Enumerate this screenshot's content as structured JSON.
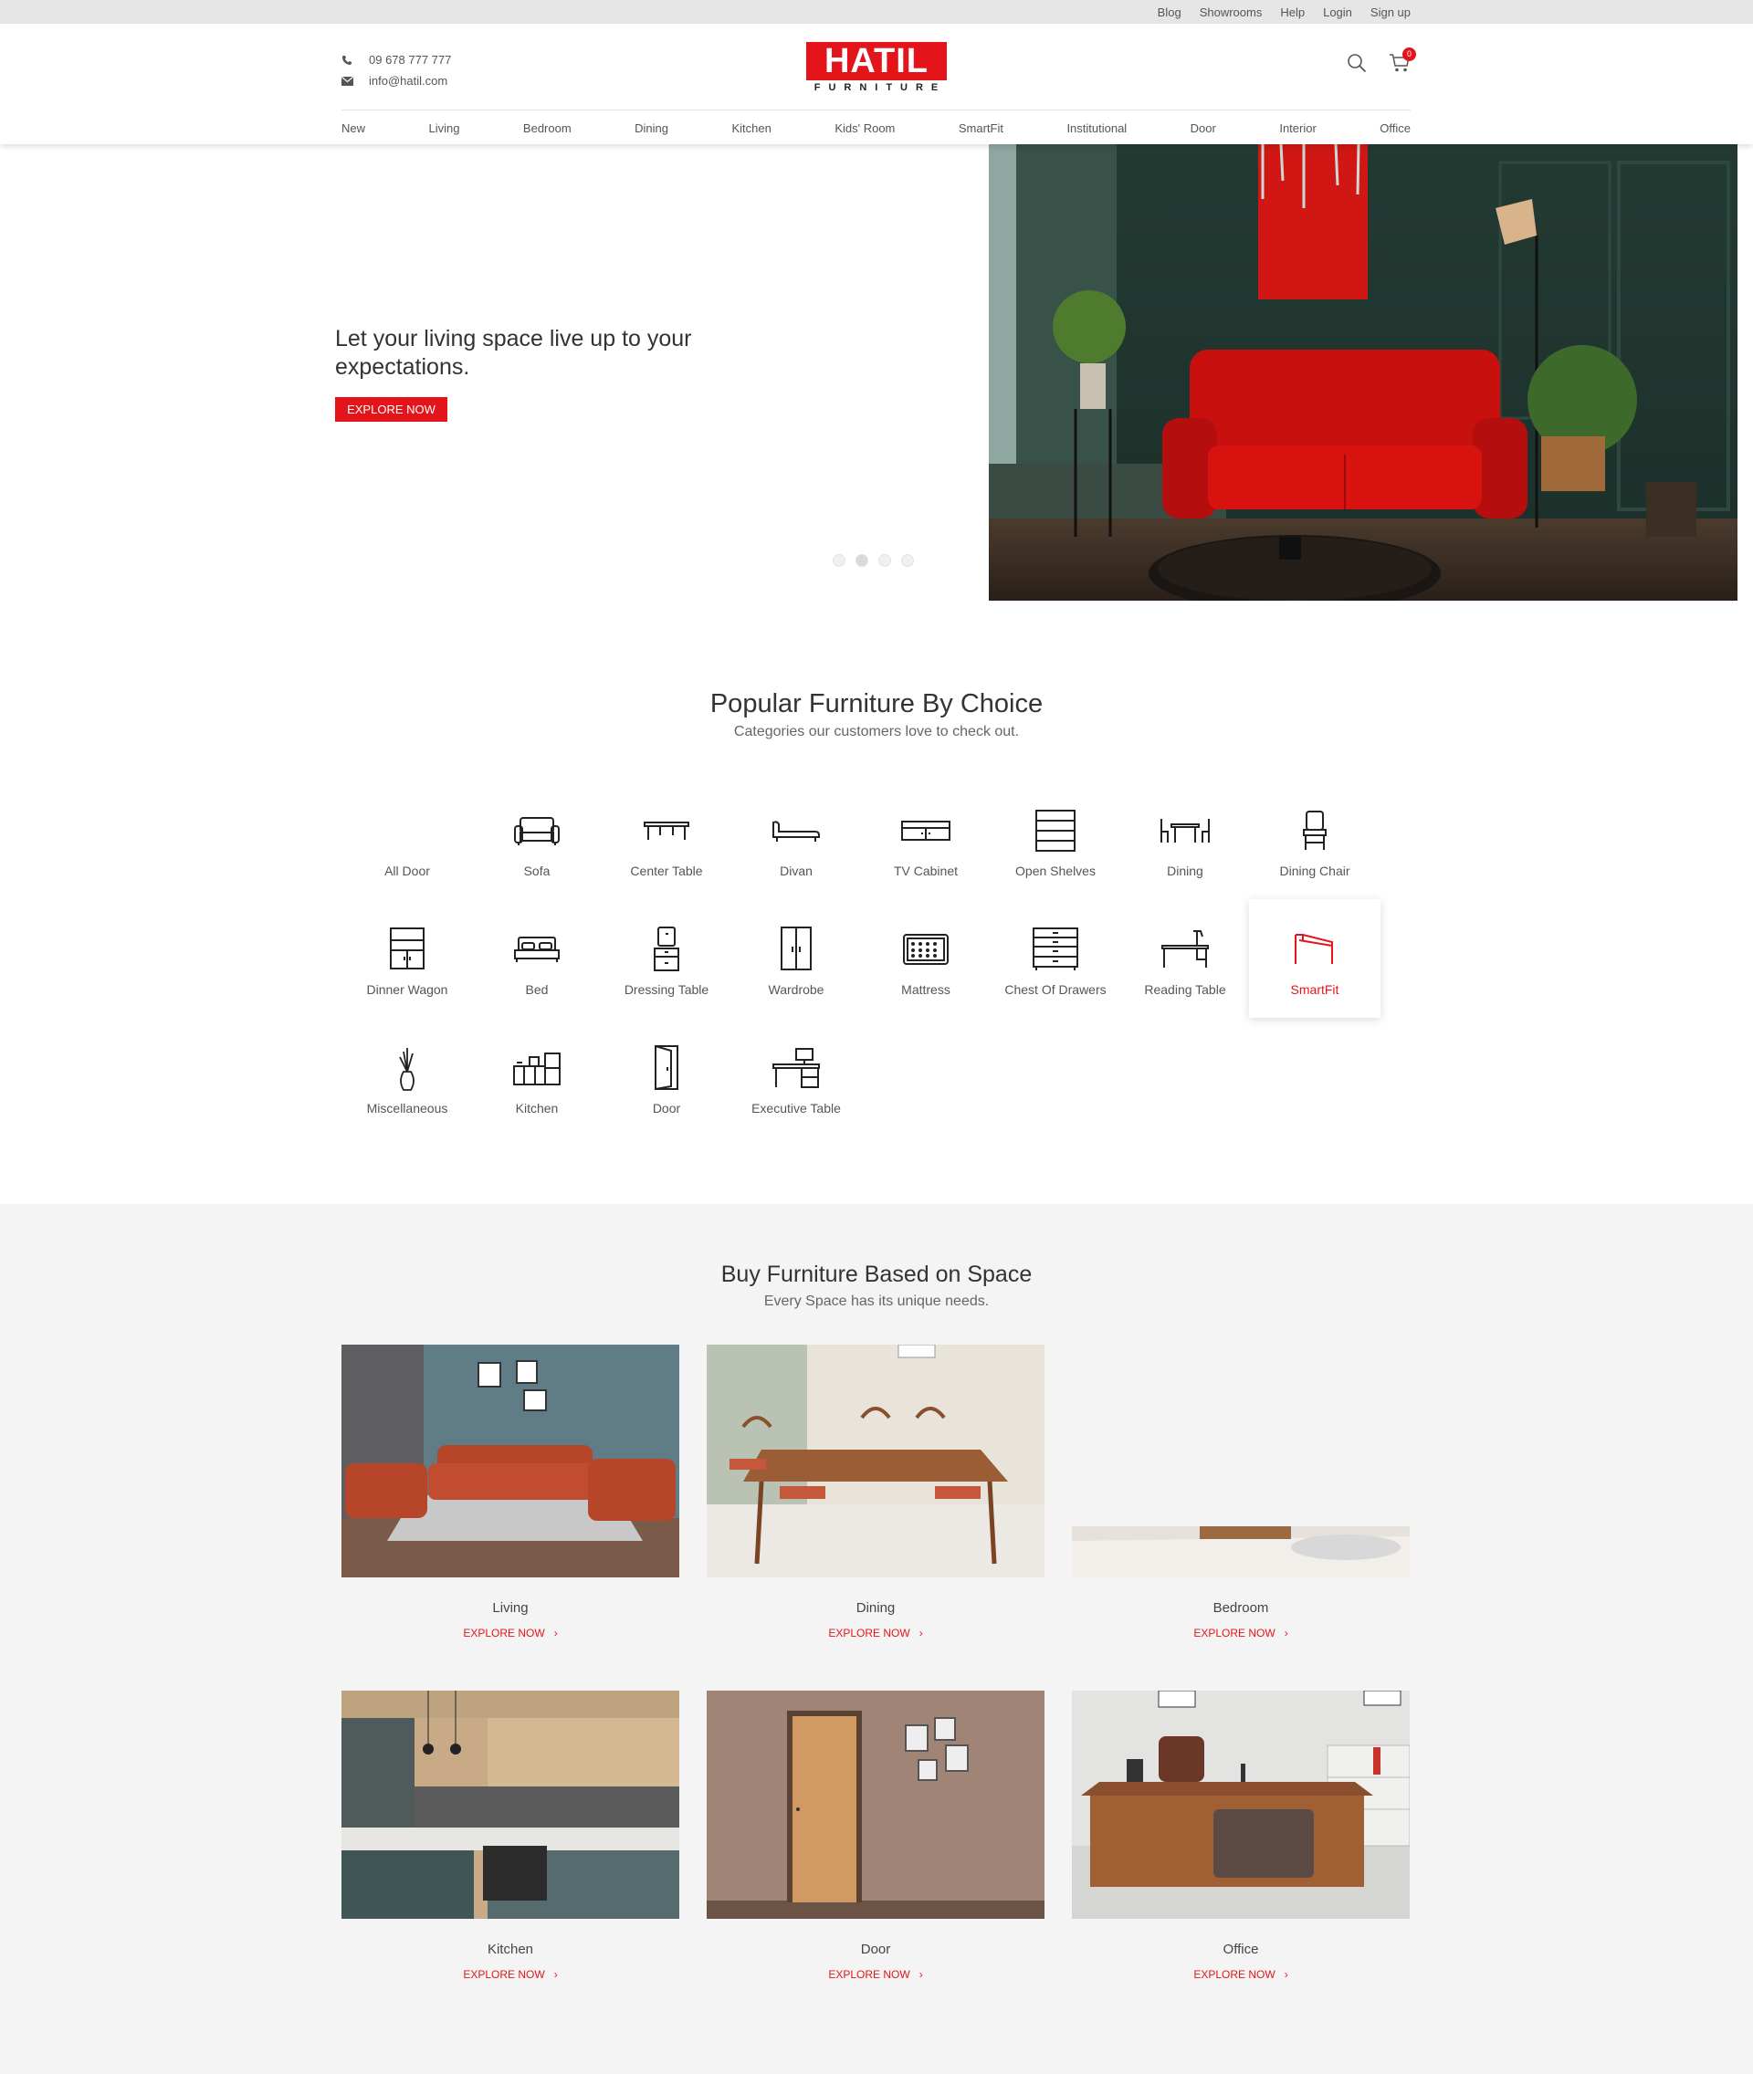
{
  "topbar": {
    "links": [
      "Blog",
      "Showrooms",
      "Help",
      "Login",
      "Sign up"
    ]
  },
  "header": {
    "phone": "09 678 777 777",
    "email": "info@hatil.com",
    "logo_main": "HATIL",
    "logo_sub": "FURNITURE",
    "cart_count": "0"
  },
  "nav": [
    "New",
    "Living",
    "Bedroom",
    "Dining",
    "Kitchen",
    "Kids' Room",
    "SmartFit",
    "Institutional",
    "Door",
    "Interior",
    "Office"
  ],
  "hero": {
    "title": "Let your living space live up to your expectations.",
    "button": "EXPLORE NOW",
    "slides": 4,
    "active_slide": 2
  },
  "popular": {
    "title": "Popular Furniture By Choice",
    "subtitle": "Categories our customers love to check out.",
    "categories": [
      {
        "label": "All Door",
        "icon": "door-icon"
      },
      {
        "label": "Sofa",
        "icon": "sofa-icon"
      },
      {
        "label": "Center Table",
        "icon": "center-table-icon"
      },
      {
        "label": "Divan",
        "icon": "divan-icon"
      },
      {
        "label": "TV Cabinet",
        "icon": "tv-cabinet-icon"
      },
      {
        "label": "Open Shelves",
        "icon": "open-shelves-icon"
      },
      {
        "label": "Dining",
        "icon": "dining-set-icon"
      },
      {
        "label": "Dining Chair",
        "icon": "dining-chair-icon"
      },
      {
        "label": "Dinner Wagon",
        "icon": "dinner-wagon-icon"
      },
      {
        "label": "Bed",
        "icon": "bed-icon"
      },
      {
        "label": "Dressing Table",
        "icon": "dressing-table-icon"
      },
      {
        "label": "Wardrobe",
        "icon": "wardrobe-icon"
      },
      {
        "label": "Mattress",
        "icon": "mattress-icon"
      },
      {
        "label": "Chest Of Drawers",
        "icon": "chest-of-drawers-icon"
      },
      {
        "label": "Reading Table",
        "icon": "reading-table-icon"
      },
      {
        "label": "SmartFit",
        "icon": "smartfit-icon"
      },
      {
        "label": "Miscellaneous",
        "icon": "vase-icon"
      },
      {
        "label": "Kitchen",
        "icon": "kitchen-icon"
      },
      {
        "label": "Door",
        "icon": "door-icon"
      },
      {
        "label": "Executive Table",
        "icon": "executive-table-icon"
      }
    ]
  },
  "space": {
    "title": "Buy Furniture Based on Space",
    "subtitle": "Every Space has its unique needs.",
    "explore_label": "EXPLORE NOW",
    "arrow": "›",
    "cards": [
      {
        "name": "Living"
      },
      {
        "name": "Dining"
      },
      {
        "name": "Bedroom"
      },
      {
        "name": "Kitchen"
      },
      {
        "name": "Door"
      },
      {
        "name": "Office"
      }
    ]
  },
  "colors": {
    "accent": "#e3151b",
    "section_bg": "#f4f4f4",
    "topbar_bg": "#e6e6e6"
  }
}
